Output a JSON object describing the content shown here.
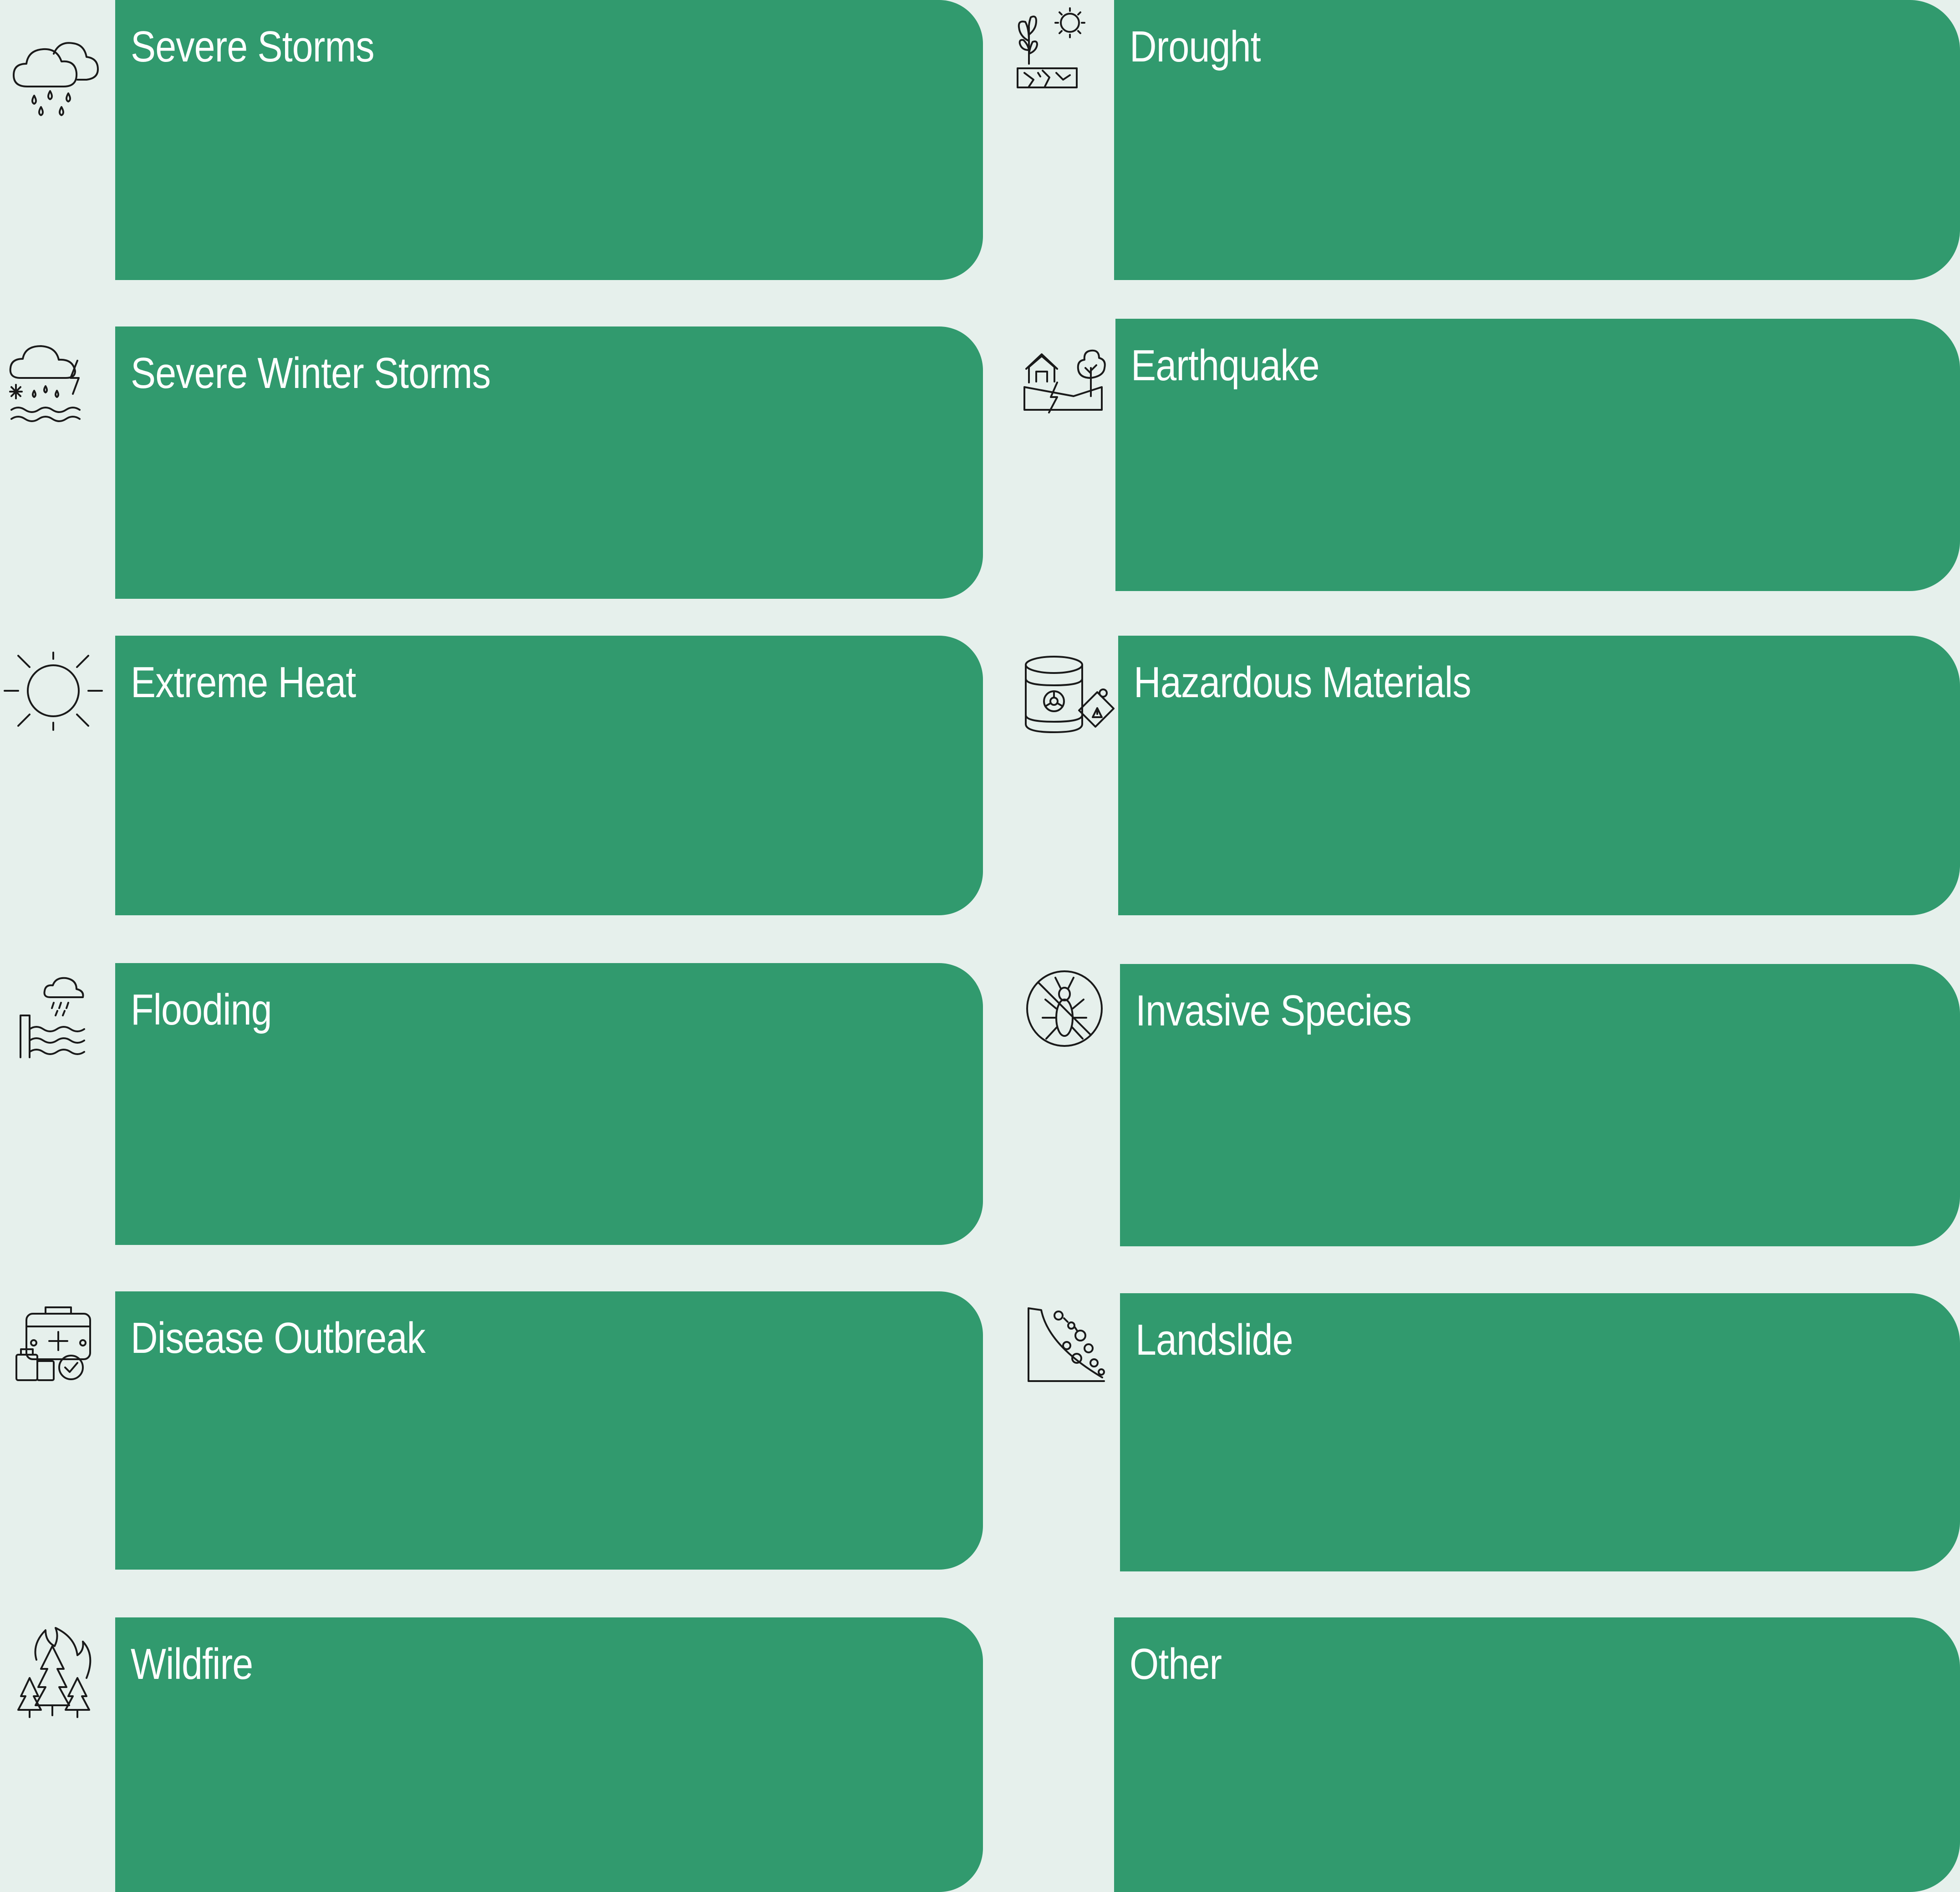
{
  "theme": {
    "background": "#e6f0ec",
    "card_color": "#319a6e",
    "text_color": "#ffffff",
    "icon_color": "#1a1a1a"
  },
  "left_column": [
    {
      "title": "Severe Storms",
      "icon": "rain-cloud-icon"
    },
    {
      "title": "Severe Winter Storms",
      "icon": "winter-storm-icon"
    },
    {
      "title": "Extreme Heat",
      "icon": "sun-icon"
    },
    {
      "title": "Flooding",
      "icon": "flood-icon"
    },
    {
      "title": "Disease Outbreak",
      "icon": "medical-kit-icon"
    },
    {
      "title": "Wildfire",
      "icon": "forest-fire-icon"
    }
  ],
  "right_column": [
    {
      "title": "Drought",
      "icon": "dry-ground-icon"
    },
    {
      "title": "Earthquake",
      "icon": "cracked-ground-icon"
    },
    {
      "title": "Hazardous Materials",
      "icon": "biohazard-barrel-icon"
    },
    {
      "title": "Invasive Species",
      "icon": "no-insect-icon"
    },
    {
      "title": "Landslide",
      "icon": "falling-rocks-icon"
    },
    {
      "title": "Other",
      "icon": ""
    }
  ]
}
